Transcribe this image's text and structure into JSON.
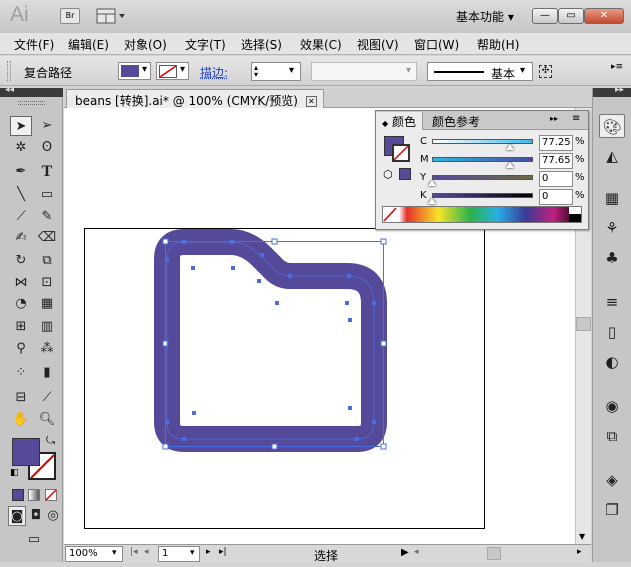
{
  "app": {
    "logo": "Ai",
    "bridge_label": "Br",
    "workspace": "基本功能"
  },
  "window_controls": {
    "minimize": "—",
    "restore": "▭",
    "close": "✕"
  },
  "menu": [
    "文件(F)",
    "编辑(E)",
    "对象(O)",
    "文字(T)",
    "选择(S)",
    "效果(C)",
    "视图(V)",
    "窗口(W)",
    "帮助(H)"
  ],
  "control_bar": {
    "selection_type": "复合路径",
    "stroke_label": "描边:",
    "stroke_weight": "",
    "stroke_style_label": "基本",
    "fill_color": "#554a9a"
  },
  "document": {
    "tab_title": "beans [转换].ai* @ 100% (CMYK/预览)"
  },
  "color_panel": {
    "tab_active": "颜色",
    "tab_other": "颜色参考",
    "channels": [
      {
        "label": "C",
        "value": "77.25",
        "unit": "%",
        "fraction": 0.7725,
        "gradient": "linear-gradient(90deg,#ffffff,#3fb9e9)"
      },
      {
        "label": "M",
        "value": "77.65",
        "unit": "%",
        "fraction": 0.7765,
        "gradient": "linear-gradient(90deg,#2fb7e6,#4a4aa3)"
      },
      {
        "label": "Y",
        "value": "0",
        "unit": "%",
        "fraction": 0,
        "gradient": "linear-gradient(90deg,#554a9a,#6e6a47)"
      },
      {
        "label": "K",
        "value": "0",
        "unit": "%",
        "fraction": 0,
        "gradient": "linear-gradient(90deg,#554a9a,#000000)"
      }
    ]
  },
  "status_bar": {
    "zoom": "100%",
    "page": "1",
    "mode": "选择"
  },
  "colors": {
    "fill": "#554a9a",
    "selection": "#4a6ee0"
  }
}
